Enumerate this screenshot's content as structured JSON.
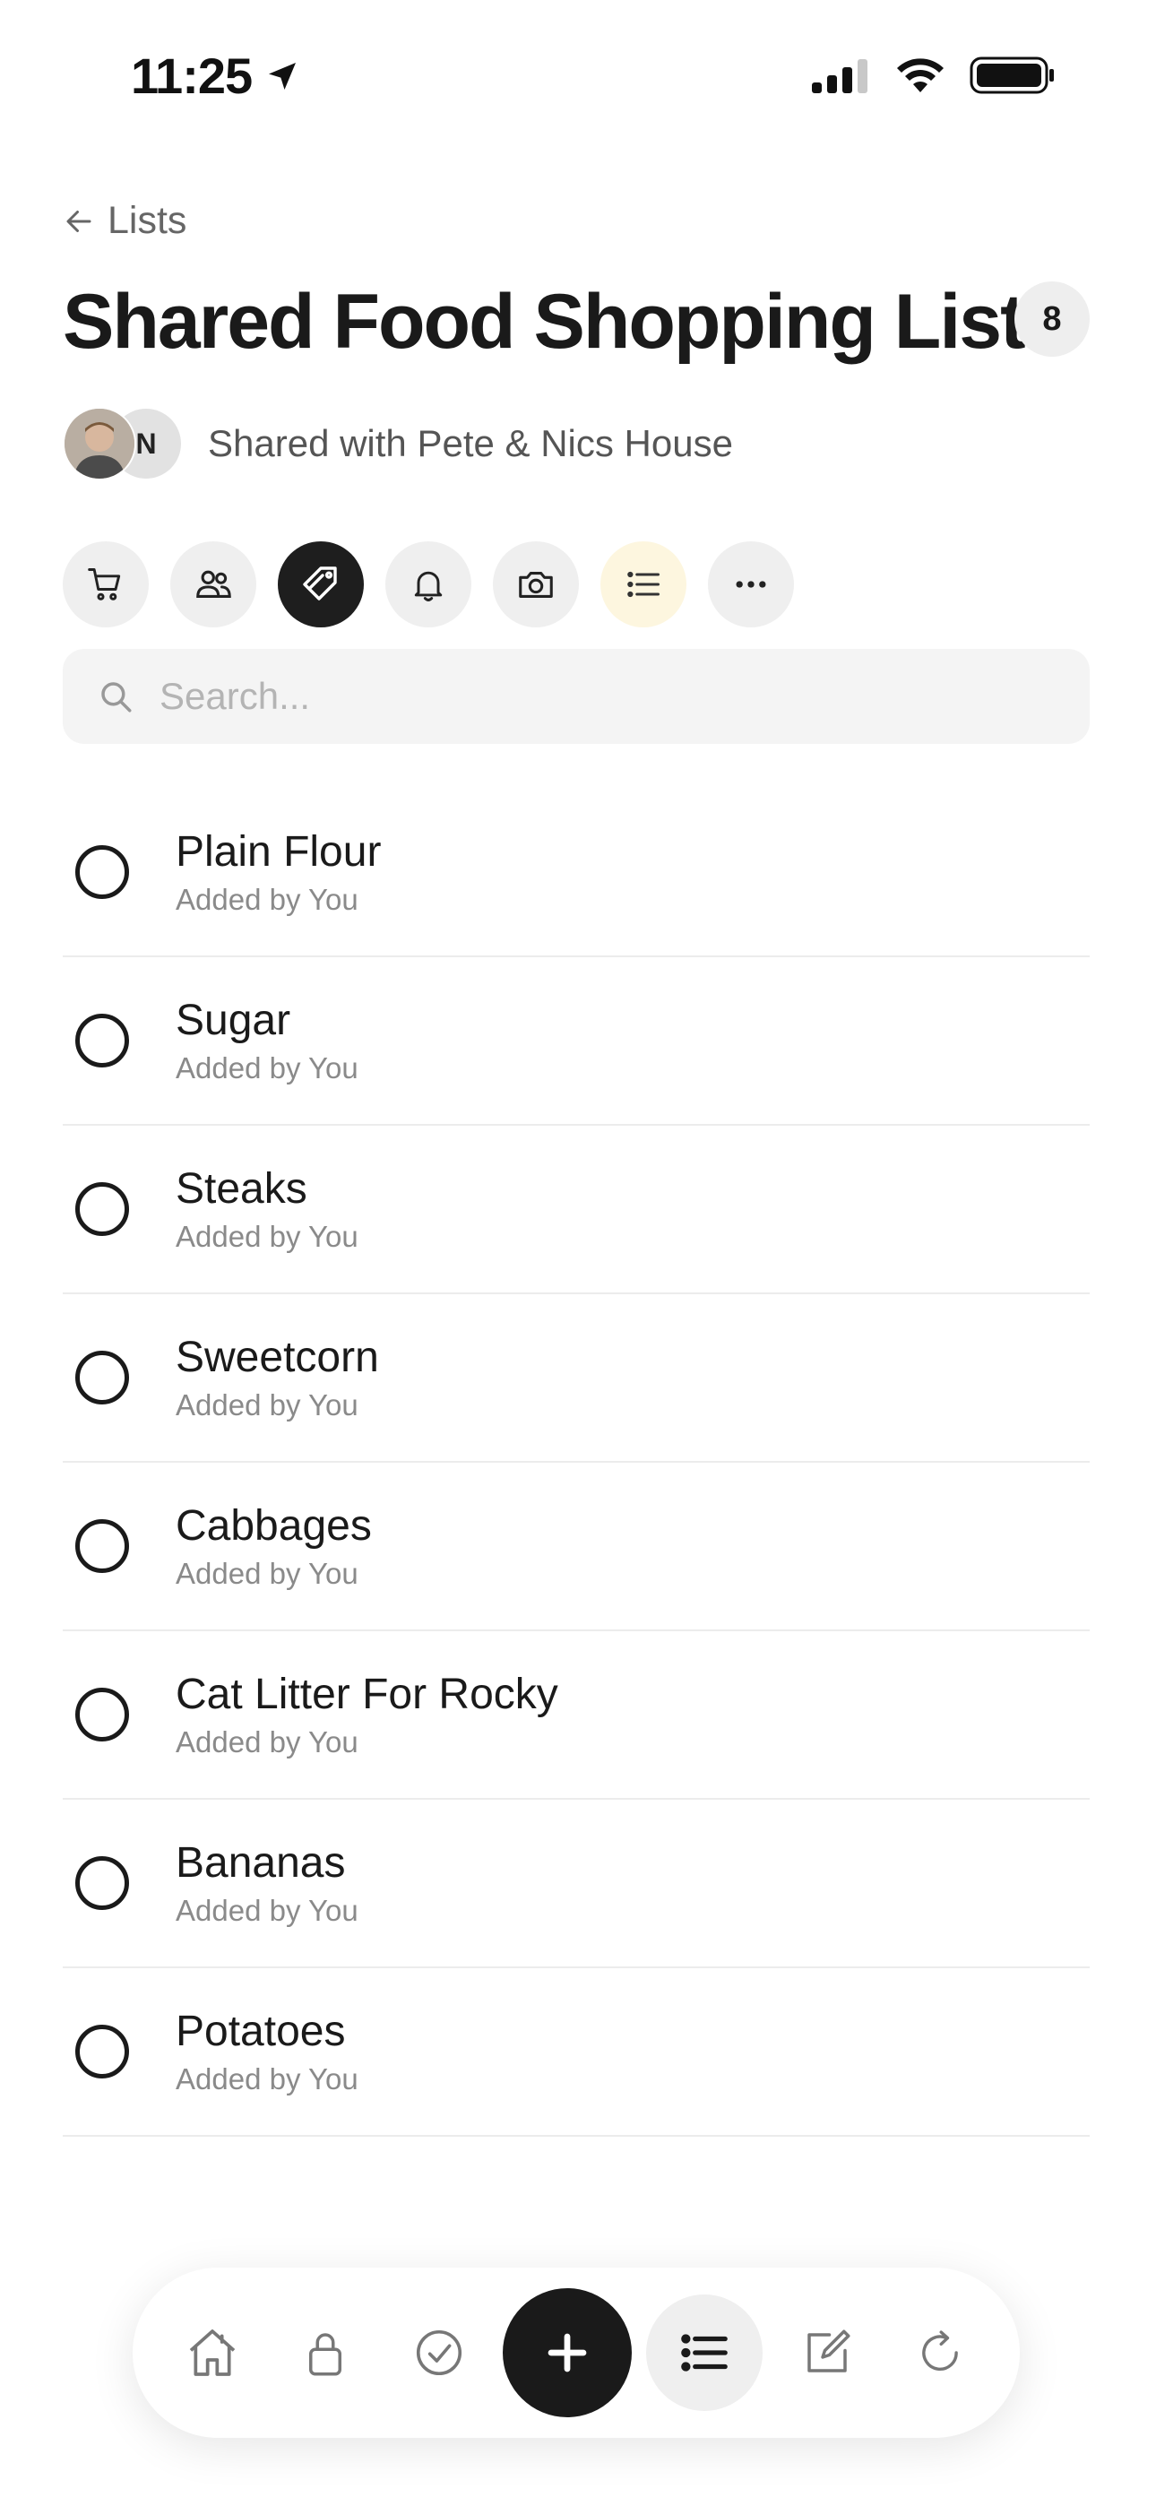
{
  "status_bar": {
    "time": "11:25"
  },
  "header": {
    "back_label": "Lists",
    "title": "Shared Food Shopping List",
    "item_count": "8",
    "shared_text": "Shared with Pete & Nics House",
    "member_initial": "N"
  },
  "toolbar": {
    "buttons": [
      "cart-icon",
      "people-icon",
      "tag-icon",
      "bell-icon",
      "camera-icon",
      "list-icon",
      "more-icon"
    ],
    "active": "tag-icon"
  },
  "search": {
    "placeholder": "Search..."
  },
  "items": [
    {
      "name": "Plain Flour",
      "added_by": "Added by You"
    },
    {
      "name": "Sugar",
      "added_by": "Added by You"
    },
    {
      "name": "Steaks",
      "added_by": "Added by You"
    },
    {
      "name": "Sweetcorn",
      "added_by": "Added by You"
    },
    {
      "name": "Cabbages",
      "added_by": "Added by You"
    },
    {
      "name": "Cat Litter For Rocky",
      "added_by": "Added by You"
    },
    {
      "name": "Bananas",
      "added_by": "Added by You"
    },
    {
      "name": "Potatoes",
      "added_by": "Added by You"
    }
  ],
  "bottom_nav": {
    "items": [
      "home-icon",
      "lock-icon",
      "check-circle-icon",
      "plus-icon",
      "list-icon",
      "edit-icon",
      "refresh-icon"
    ],
    "current": "list-icon"
  },
  "colors": {
    "text": "#1a1a1a",
    "muted": "#8a8a8a",
    "chip_bg": "#efefef",
    "active_chip": "#1e1e1e",
    "warm_chip": "#fdf6df"
  }
}
